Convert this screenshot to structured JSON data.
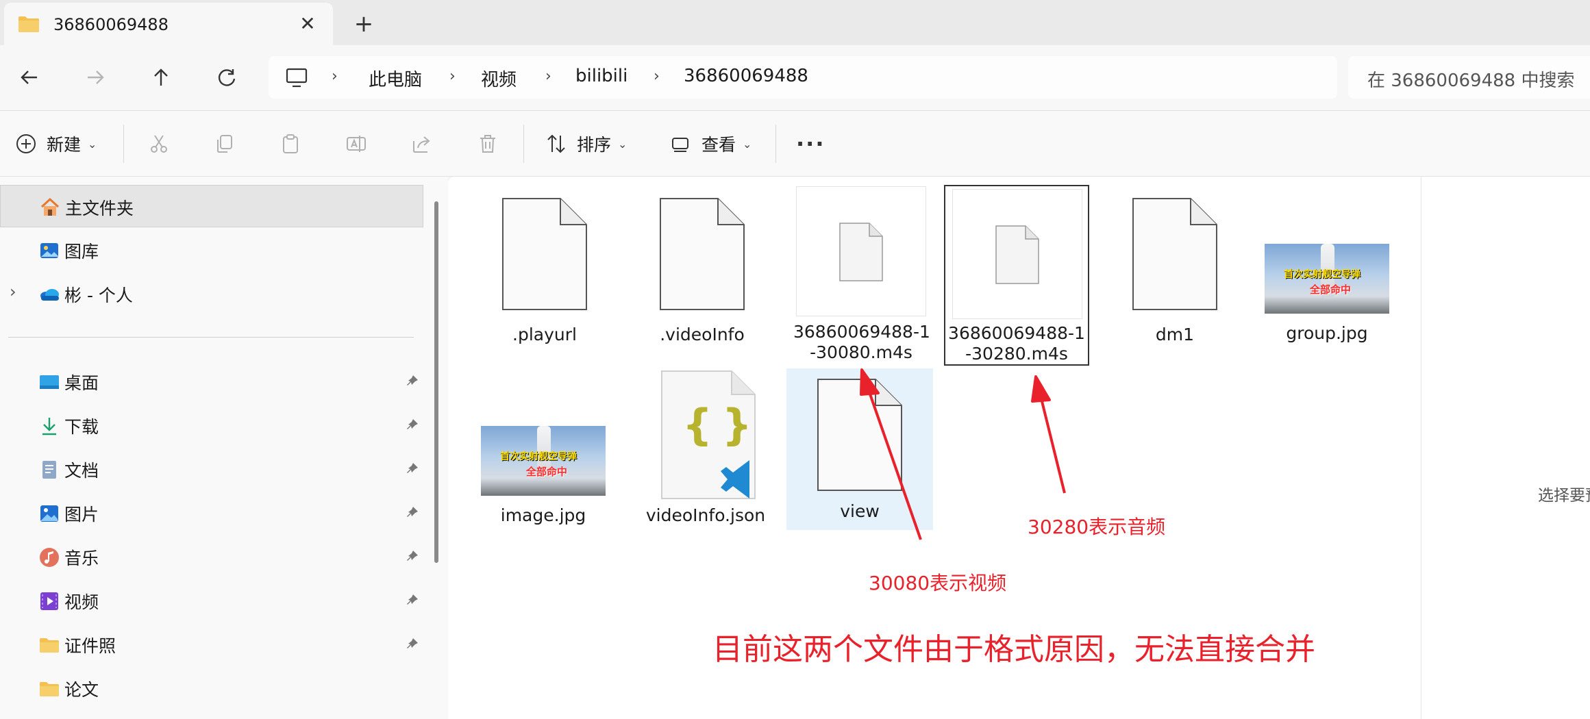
{
  "window": {
    "tab_title": "36860069488",
    "tab_close": "✕",
    "new_tab": "+"
  },
  "address": {
    "crumbs": [
      "此电脑",
      "视频",
      "bilibili",
      "36860069488"
    ],
    "separator": "›",
    "search_placeholder": "在 36860069488 中搜索"
  },
  "toolbar": {
    "new_label": "新建",
    "sort_label": "排序",
    "view_label": "查看",
    "more": "···"
  },
  "sidebar": {
    "top_items": [
      {
        "label": "主文件夹",
        "icon": "home-icon",
        "selected": true
      },
      {
        "label": "图库",
        "icon": "gallery-icon"
      },
      {
        "label": "彬 - 个人",
        "icon": "onedrive-icon",
        "expandable": true
      }
    ],
    "pinned_items": [
      {
        "label": "桌面",
        "icon": "desktop-icon"
      },
      {
        "label": "下载",
        "icon": "download-icon"
      },
      {
        "label": "文档",
        "icon": "document-icon"
      },
      {
        "label": "图片",
        "icon": "pictures-icon"
      },
      {
        "label": "音乐",
        "icon": "music-icon"
      },
      {
        "label": "视频",
        "icon": "videos-icon"
      },
      {
        "label": "证件照",
        "icon": "folder-icon"
      },
      {
        "label": "论文",
        "icon": "folder-icon"
      }
    ]
  },
  "files": [
    {
      "name": ".playurl",
      "type": "blank"
    },
    {
      "name": ".videoInfo",
      "type": "blank"
    },
    {
      "name_line1": "36860069488-1",
      "name_line2": "-30080.m4s",
      "type": "m4s"
    },
    {
      "name_line1": "36860069488-1",
      "name_line2": "-30280.m4s",
      "type": "m4s",
      "selected": true
    },
    {
      "name": "dm1",
      "type": "blank"
    },
    {
      "name": "group.jpg",
      "type": "image",
      "thumb_text1": "首次实射舰空导弹",
      "thumb_text2": "全部命中"
    },
    {
      "name": "image.jpg",
      "type": "image",
      "thumb_text1": "首次实射舰空导弹",
      "thumb_text2": "全部命中"
    },
    {
      "name": "videoInfo.json",
      "type": "json",
      "glyph": "{ }"
    },
    {
      "name": "view",
      "type": "blank",
      "hovered": true
    }
  ],
  "details_pane": {
    "text": "选择要预"
  },
  "annotations": {
    "audio_note": "30280表示音频",
    "video_note": "30080表示视频",
    "merge_note": "目前这两个文件由于格式原因，无法直接合并"
  },
  "colors": {
    "annotation": "#e8212b",
    "hover": "#e5f1fb",
    "folder": "#f4c04f"
  }
}
